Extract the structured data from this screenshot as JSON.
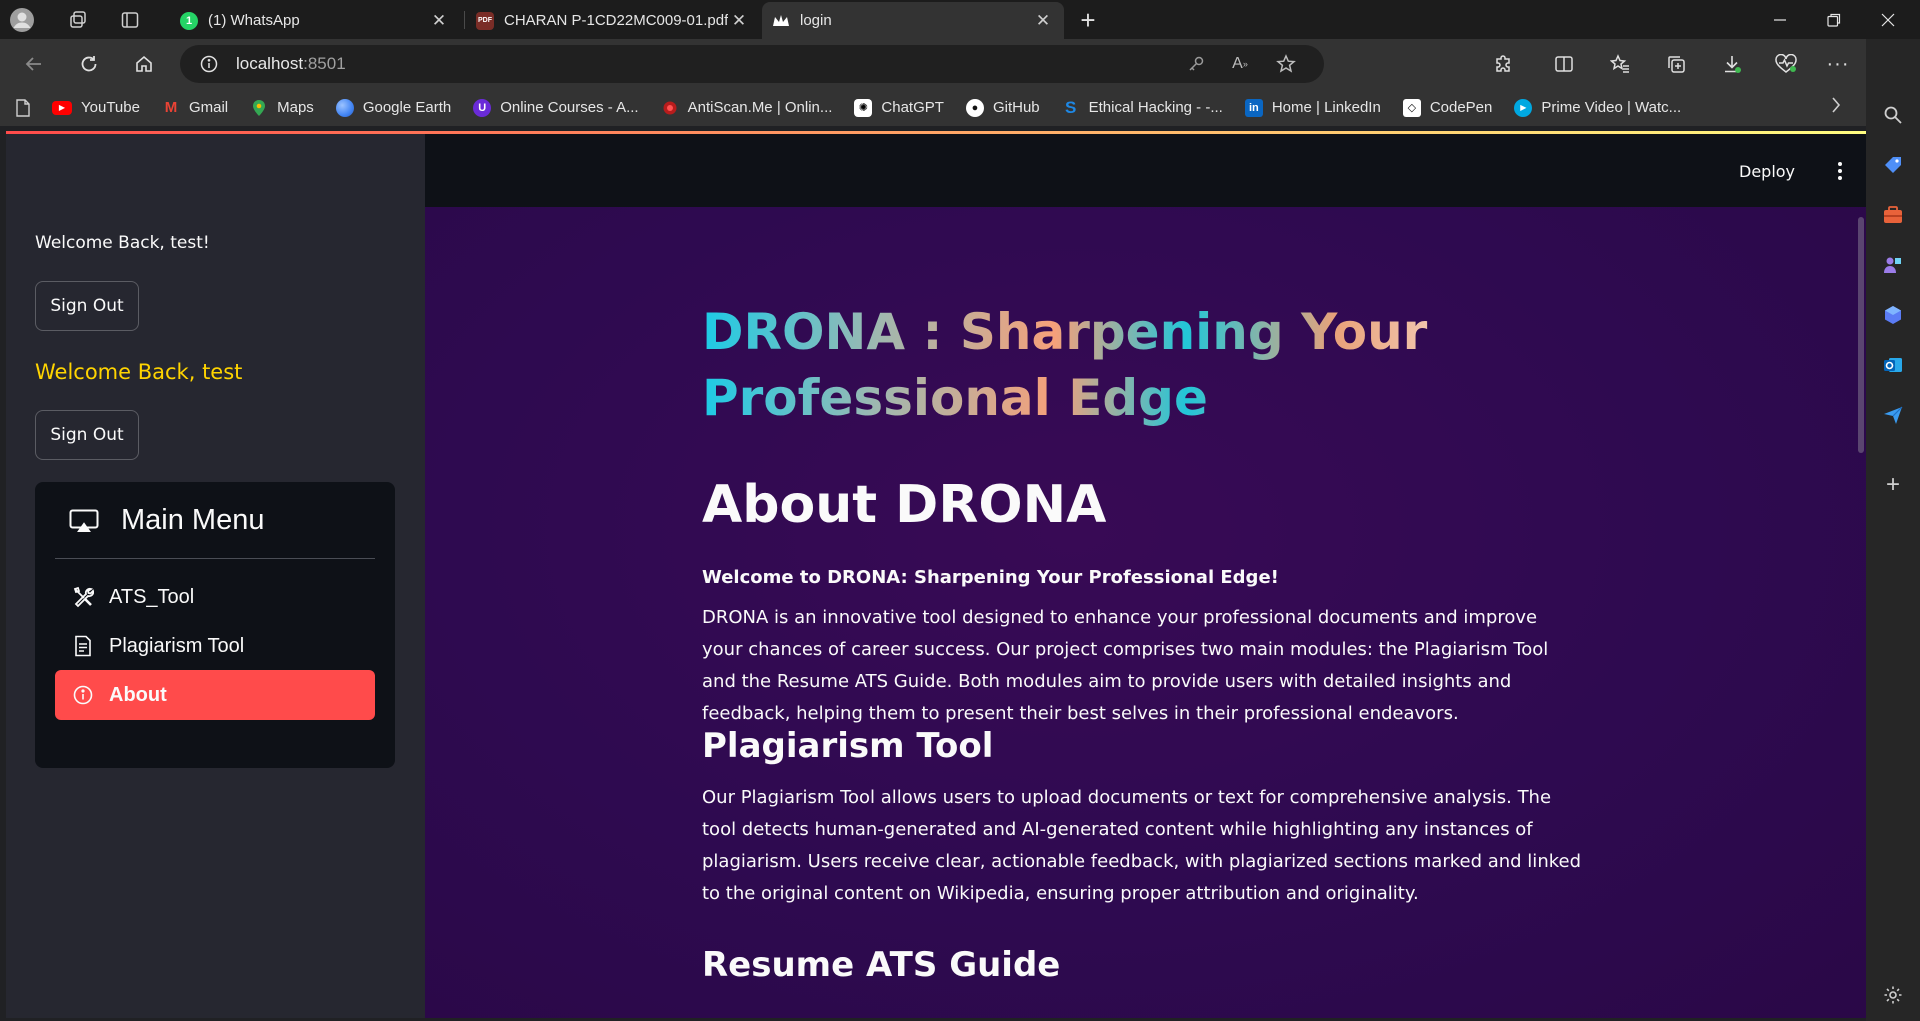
{
  "browser": {
    "tabs": [
      {
        "title": "(1) WhatsApp",
        "favicon_color": "#25d366",
        "favicon_text": "1"
      },
      {
        "title": "CHARAN P-1CD22MC009-01.pdf",
        "favicon_color": "#b03a2e",
        "favicon_text": "PDF"
      },
      {
        "title": "login",
        "favicon_color": "#ffffff",
        "favicon_text": ""
      }
    ],
    "address": {
      "host": "localhost",
      "port": ":8501"
    },
    "bookmarks": [
      {
        "label": "YouTube",
        "icon": "youtube-icon",
        "color": "#ff0000"
      },
      {
        "label": "Gmail",
        "icon": "gmail-icon",
        "color": "#ea4335"
      },
      {
        "label": "Maps",
        "icon": "maps-icon",
        "color": "#34a853"
      },
      {
        "label": "Google Earth",
        "icon": "google-earth-icon",
        "color": "#4285f4"
      },
      {
        "label": "Online Courses - A...",
        "icon": "courses-icon",
        "color": "#6a2bd8"
      },
      {
        "label": "AntiScan.Me | Onlin...",
        "icon": "antiscan-icon",
        "color": "#d32f2f"
      },
      {
        "label": "ChatGPT",
        "icon": "chatgpt-icon",
        "color": "#ffffff"
      },
      {
        "label": "GitHub",
        "icon": "github-icon",
        "color": "#ffffff"
      },
      {
        "label": "Ethical Hacking - -...",
        "icon": "ethical-hacking-icon",
        "color": "#1e88e5"
      },
      {
        "label": "Home | LinkedIn",
        "icon": "linkedin-icon",
        "color": "#0a66c2"
      },
      {
        "label": "CodePen",
        "icon": "codepen-icon",
        "color": "#ffffff"
      },
      {
        "label": "Prime Video | Watc...",
        "icon": "prime-video-icon",
        "color": "#00a8e1"
      }
    ]
  },
  "sidebar": {
    "welcome_text": "Welcome Back, test!",
    "signout_label": "Sign Out",
    "welcome_yellow": "Welcome Back, test",
    "signout_label_2": "Sign Out",
    "menu": {
      "title": "Main Menu",
      "items": [
        {
          "label": "ATS_Tool",
          "icon": "tools-icon",
          "selected": false
        },
        {
          "label": "Plagiarism Tool",
          "icon": "document-icon",
          "selected": false
        },
        {
          "label": "About",
          "icon": "info-icon",
          "selected": true
        }
      ]
    }
  },
  "header": {
    "deploy_label": "Deploy"
  },
  "main": {
    "hero_line1": "DRONA : Sharpening Your",
    "hero_line2": "Professional Edge",
    "about_heading": "About DRONA",
    "welcome_strong": "Welcome to DRONA: Sharpening Your Professional Edge!",
    "intro": "DRONA is an innovative tool designed to enhance your professional documents and improve your chances of career success. Our project comprises two main modules: the Plagiarism Tool and the Resume ATS Guide. Both modules aim to provide users with detailed insights and feedback, helping them to present their best selves in their professional endeavors.",
    "plag_heading": "Plagiarism Tool",
    "plag_text": "Our Plagiarism Tool allows users to upload documents or text for comprehensive analysis. The tool detects human-generated and AI-generated content while highlighting any instances of plagiarism. Users receive clear, actionable feedback, with plagiarized sections marked and linked to the original content on Wikipedia, ensuring proper attribution and originality.",
    "resume_heading": "Resume ATS Guide"
  },
  "colors": {
    "primary": "#ff4b4b",
    "sidebar_bg": "#262730",
    "main_bg": "#2e0a50",
    "header_bg": "#0e1117",
    "welcome_yellow": "#ffd400"
  }
}
